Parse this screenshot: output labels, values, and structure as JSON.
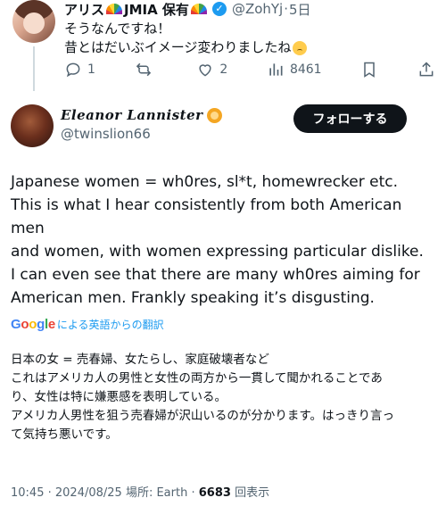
{
  "reply": {
    "name": "アリス",
    "name_suffix": "JMIA 保有",
    "handle": "@ZohYj",
    "separator": "·",
    "time": "5日",
    "line1": "そうなんですね！",
    "line2": "昔とはだいぶイメージ変わりましたね",
    "actions": {
      "reply_count": "1",
      "retweet_count": "",
      "like_count": "2",
      "view_count": "8461"
    }
  },
  "tweet": {
    "display_name": "Eleanor Lannister",
    "handle": "@twinslion66",
    "follow_label": "フォローする",
    "text_en": [
      "Japanese women = wh0res, sl*t, homewrecker etc.",
      "This is what I hear consistently from both American men",
      "and women, with women expressing particular dislike.",
      "I can even see that there are many wh0res aiming for",
      "American men. Frankly speaking it’s disgusting."
    ],
    "translate_label": "による英語からの翻訳",
    "google_letters": [
      "G",
      "o",
      "o",
      "g",
      "l",
      "e"
    ],
    "text_ja": [
      "日本の女 = 売春婦、女たらし、家庭破壊者など",
      "これはアメリカ人の男性と女性の両方から一貫して聞かれることであ",
      "り、女性は特に嫌悪感を表明している。",
      "アメリカ人男性を狙う売春婦が沢山いるのが分かります。はっきり言っ",
      "て気持ち悪いです。"
    ],
    "meta": {
      "time": "10:45",
      "date": "2024/08/25",
      "location_label": "場所: Earth",
      "views": "6683",
      "views_label": "回表示"
    }
  },
  "icons": [
    "reply-icon",
    "retweet-icon",
    "like-icon",
    "views-icon",
    "bookmark-icon",
    "share-icon",
    "verified-icon",
    "rainbow-emoji",
    "crying-emoji",
    "lion-emoji"
  ],
  "colors": {
    "accent": "#1d9bf0",
    "text": "#0f1419",
    "secondary": "#536471",
    "button_bg": "#0f1419"
  }
}
